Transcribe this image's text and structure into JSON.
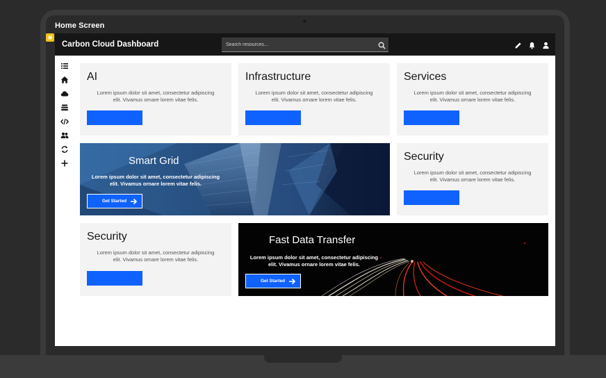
{
  "window": {
    "title": "Home Screen"
  },
  "header": {
    "app_title": "Carbon Cloud Dashboard",
    "search_placeholder": "Search resources..."
  },
  "cards": {
    "ai": {
      "title": "AI",
      "body": "Lorem ipsum dolor sit amet, consectetur adipiscing elit. Vivamus ornare lorem vitae felis."
    },
    "infrastructure": {
      "title": "Infrastructure",
      "body": "Lorem ipsum dolor sit amet, consectetur adipiscing elit. Vivamus ornare lorem vitae felis."
    },
    "services": {
      "title": "Services",
      "body": "Lorem ipsum dolor sit amet, consectetur adipiscing elit. Vivamus ornare lorem vitae felis."
    },
    "security_right": {
      "title": "Security",
      "body": "Lorem ipsum dolor sit amet, consectetur adipiscing elit. Vivamus ornare lorem vitae felis."
    },
    "security_left": {
      "title": "Security",
      "body": "Lorem ipsum dolor sit amet, consectetur adipiscing elit. Vivamus ornare lorem vitae felis."
    }
  },
  "heroes": {
    "smart_grid": {
      "title": "Smart Grid",
      "body": "Lorem ipsum dolor sit amet, consectetur adipiscing elit. Vivamus ornare lorem vitae felis.",
      "cta": "Get Started"
    },
    "fast_data": {
      "title": "Fast Data Transfer",
      "body": "Lorem ipsum dolor sit amet, consectetur adipiscing elit. Vivamus ornare lorem vitae felis.",
      "cta": "Get Started"
    }
  },
  "icons": {
    "header": [
      "edit-icon",
      "notification-icon",
      "user-icon"
    ],
    "sidebar": [
      "list-icon",
      "home-icon",
      "cloud-icon",
      "layers-icon",
      "code-icon",
      "group-icon",
      "refresh-icon",
      "add-icon"
    ]
  },
  "colors": {
    "primary": "#0f62fe",
    "header_bg": "#161616",
    "card_bg": "#f3f3f3"
  }
}
